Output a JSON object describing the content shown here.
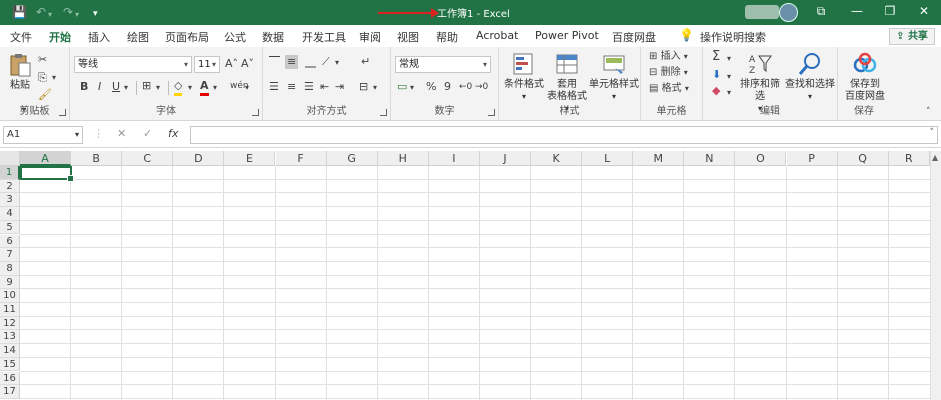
{
  "titlebar": {
    "title": "工作簿1 - Excel",
    "save_icon": "💾",
    "undo_icon": "↶",
    "redo_icon": "↷",
    "customize_icon": "▾",
    "ribbon_display_icon": "⧉",
    "minimize_icon": "—",
    "restore_icon": "❐",
    "close_icon": "✕"
  },
  "tabs": [
    "文件",
    "开始",
    "插入",
    "绘图",
    "页面布局",
    "公式",
    "数据",
    "审阅",
    "视图",
    "开发工具",
    "帮助",
    "Acrobat",
    "Power Pivot",
    "百度网盘"
  ],
  "active_tab": "开始",
  "tell_me": "操作说明搜索",
  "share_label": "共享",
  "ribbon": {
    "clipboard": {
      "label": "剪贴板",
      "paste": "粘贴"
    },
    "font": {
      "label": "字体",
      "font_name": "等线",
      "font_size": "11",
      "grow": "A˄",
      "shrink": "A˅",
      "bold": "B",
      "italic": "I",
      "underline": "U",
      "pinyin": "wén"
    },
    "alignment": {
      "label": "对齐方式"
    },
    "number": {
      "label": "数字",
      "format": "常规",
      "percent": "%",
      "comma": "9"
    },
    "styles": {
      "label": "样式",
      "conditional": "条件格式",
      "table_line1": "套用",
      "table_line2": "表格格式",
      "cell_styles": "单元格样式"
    },
    "cells": {
      "label": "单元格",
      "insert": "插入",
      "delete": "删除",
      "format": "格式"
    },
    "editing": {
      "label": "编辑",
      "sum": "Σ",
      "sort_filter": "排序和筛选",
      "find_select": "查找和选择"
    },
    "save": {
      "label": "保存",
      "line1": "保存到",
      "line2": "百度网盘"
    }
  },
  "formula_bar": {
    "name_box": "A1",
    "cancel": "✕",
    "enter": "✓",
    "fx": "fx",
    "value": ""
  },
  "columns": [
    "A",
    "B",
    "C",
    "D",
    "E",
    "F",
    "G",
    "H",
    "I",
    "J",
    "K",
    "L",
    "M",
    "N",
    "O",
    "P",
    "Q",
    "R"
  ],
  "rows": [
    "1",
    "2",
    "3",
    "4",
    "5",
    "6",
    "7",
    "8",
    "9",
    "10",
    "11",
    "12",
    "13",
    "14",
    "15",
    "16",
    "17"
  ],
  "selected_cell": "A1",
  "colors": {
    "accent": "#217346",
    "annotation_arrow": "#d22222"
  }
}
